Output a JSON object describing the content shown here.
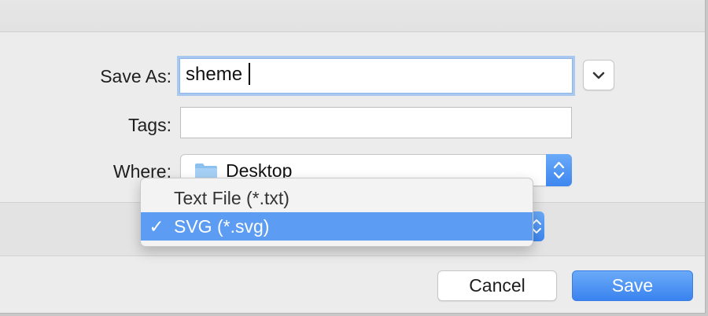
{
  "form": {
    "save_as_label": "Save As:",
    "save_as_value": "sheme",
    "tags_label": "Tags:",
    "tags_value": "",
    "where_label": "Where:",
    "where_value": "Desktop"
  },
  "format_menu": {
    "items": [
      {
        "label": "Text File (*.txt)",
        "selected": false
      },
      {
        "label": "SVG (*.svg)",
        "selected": true,
        "check": "✓"
      }
    ]
  },
  "buttons": {
    "cancel": "Cancel",
    "save": "Save"
  },
  "icons": {
    "expand": "chevron-down-icon",
    "folder": "folder-icon",
    "stepper": "up-down-arrows-icon"
  },
  "colors": {
    "accent": "#3e86f0",
    "selected_menu": "#5c9cf2",
    "focus_ring": "#a9c8f0"
  }
}
